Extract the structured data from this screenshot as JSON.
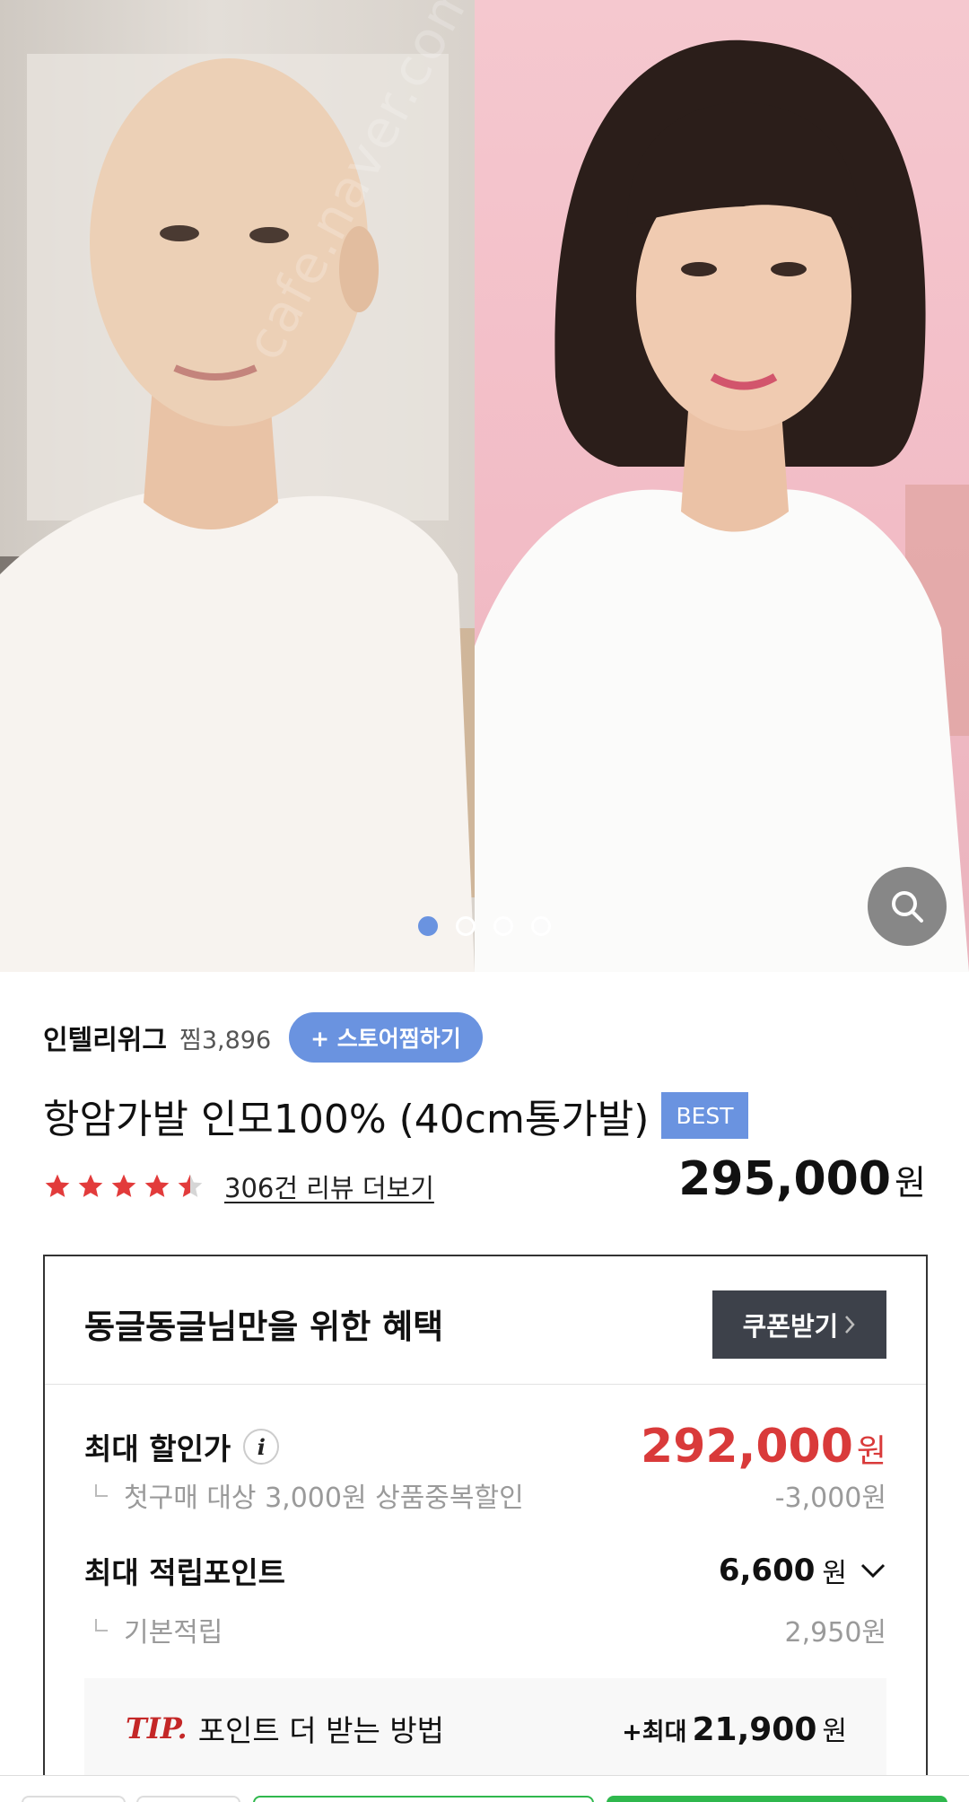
{
  "carousel": {
    "slide_count": 4,
    "active_index": 0,
    "watermark": "cafe.naver.com/joonggonara",
    "zoom_icon": "search-icon"
  },
  "store": {
    "name": "인텔리위그",
    "likes": "찜3,896",
    "like_button": "+ 스토어찜하기"
  },
  "product": {
    "title": "항암가발 인모100% (40cm통가발)",
    "badge": "BEST",
    "rating": 4.5,
    "reviews_link": "306건 리뷰 더보기",
    "price": "295,000",
    "price_unit": "원"
  },
  "benefit": {
    "title": "동글동글님만을 위한 혜택",
    "coupon_button": "쿠폰받기",
    "max_discount_label": "최대 할인가",
    "max_discount_price": "292,000",
    "max_discount_unit": "원",
    "first_purchase_label": "첫구매 대상 3,000원 상품중복할인",
    "first_purchase_value": "-3,000원",
    "max_points_label": "최대 적립포인트",
    "max_points_value": "6,600",
    "max_points_unit": "원",
    "basic_points_label": "기본적립",
    "basic_points_value": "2,950원",
    "tip_label": "TIP.",
    "tip_text": "포인트 더 받는 방법",
    "tip_prefix": "+최대",
    "tip_value": "21,900",
    "tip_unit": "원"
  },
  "colors": {
    "accent_blue": "#6a93e0",
    "discount_red": "#d93a3a",
    "star_red": "#e23b3b",
    "coupon_dark": "#3d414a",
    "buy_green": "#2fb84d"
  }
}
